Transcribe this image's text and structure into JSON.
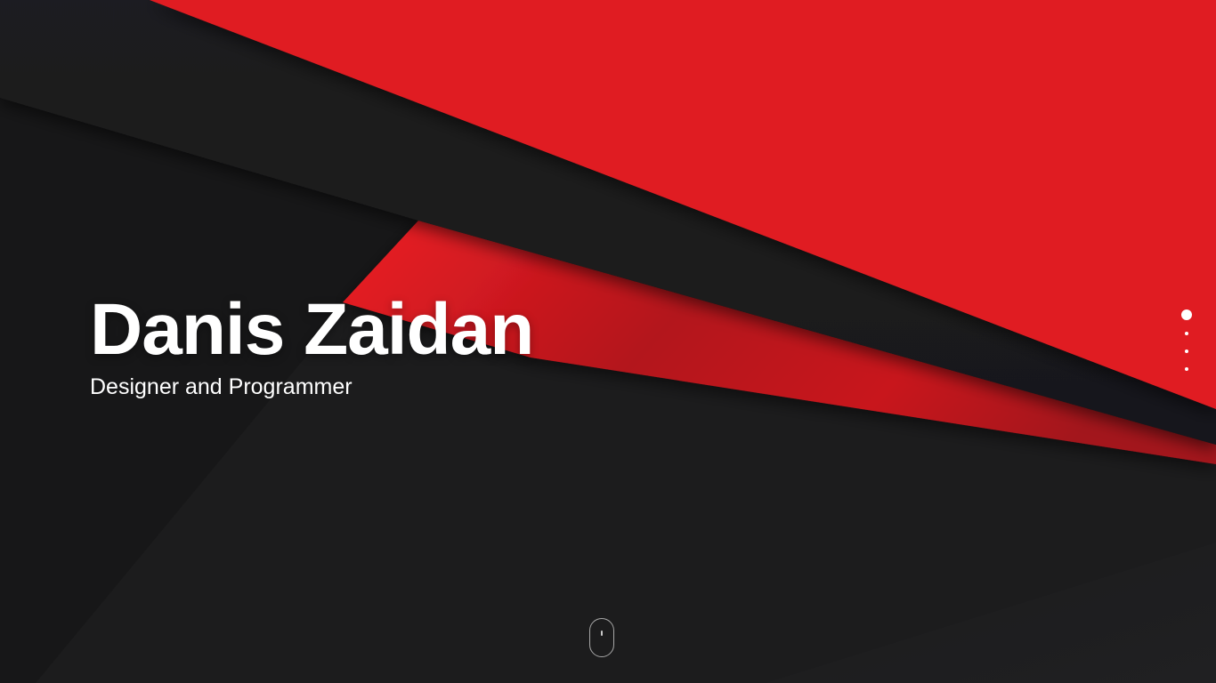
{
  "hero": {
    "title": "Danis Zaidan",
    "subtitle": "Designer and Programmer"
  },
  "section_nav": {
    "dots": [
      {
        "active": true
      },
      {
        "active": false
      },
      {
        "active": false
      },
      {
        "active": false
      }
    ]
  },
  "scroll_indicator": {
    "icon": "mouse-scroll-icon"
  },
  "colors": {
    "accent_red": "#e01b22",
    "dark_background": "#1c1c1d",
    "text": "#ffffff"
  }
}
